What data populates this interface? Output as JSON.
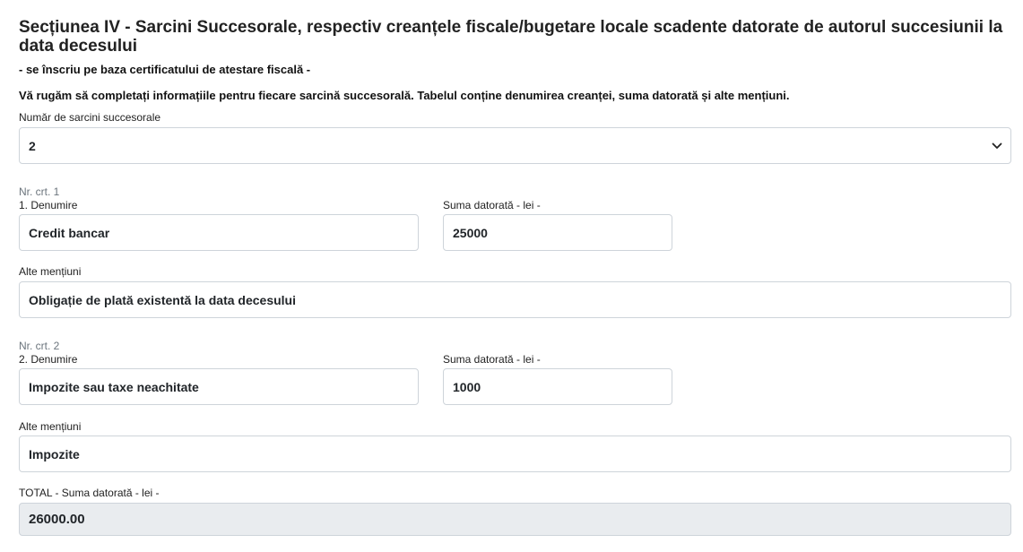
{
  "section": {
    "title": "Secțiunea IV - Sarcini Succesorale, respectiv creanțele fiscale/bugetare locale scadente datorate de autorul succesiunii la data decesului",
    "subtitle": "- se înscriu pe baza certificatului de atestare fiscală -",
    "instructions": "Vă rugăm să completați informațiile pentru fiecare sarcină succesorală. Tabelul conține denumirea creanței, suma datorată și alte mențiuni."
  },
  "count_select": {
    "label": "Număr de sarcini succesorale",
    "value": "2",
    "icon": "chevron-down-icon"
  },
  "items": [
    {
      "nr_label": "Nr. crt. 1",
      "denumire_label": "1. Denumire",
      "denumire_value": "Credit bancar",
      "suma_label": "Suma datorată - lei -",
      "suma_value": "25000",
      "mentiuni_label": "Alte mențiuni",
      "mentiuni_value": "Obligație de plată existentă la data decesului"
    },
    {
      "nr_label": "Nr. crt. 2",
      "denumire_label": "2. Denumire",
      "denumire_value": "Impozite sau taxe neachitate",
      "suma_label": "Suma datorată - lei -",
      "suma_value": "1000",
      "mentiuni_label": "Alte mențiuni",
      "mentiuni_value": "Impozite"
    }
  ],
  "total": {
    "label": "TOTAL - Suma datorată - lei -",
    "value": "26000.00"
  }
}
